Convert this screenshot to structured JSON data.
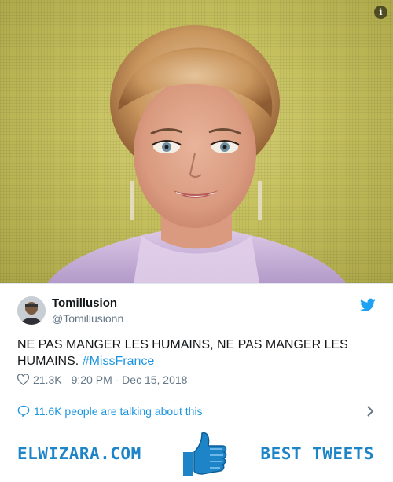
{
  "media": {
    "info_glyph": "i"
  },
  "tweet": {
    "author_name": "Tomillusion",
    "author_handle": "@Tomillusionn",
    "text": "NE PAS MANGER LES HUMAINS, NE PAS MANGER LES HUMAINS.",
    "hashtag": "#MissFrance",
    "likes": "21.3K",
    "timestamp": "9:20 PM - Dec 15, 2018",
    "talking": "11.6K people are talking about this"
  },
  "banner": {
    "left_text": "ELWIZARA.COM",
    "right_text": "BEST TWEETS"
  },
  "colors": {
    "twitter_blue": "#1b95e0",
    "banner_blue": "#1d84c8"
  }
}
